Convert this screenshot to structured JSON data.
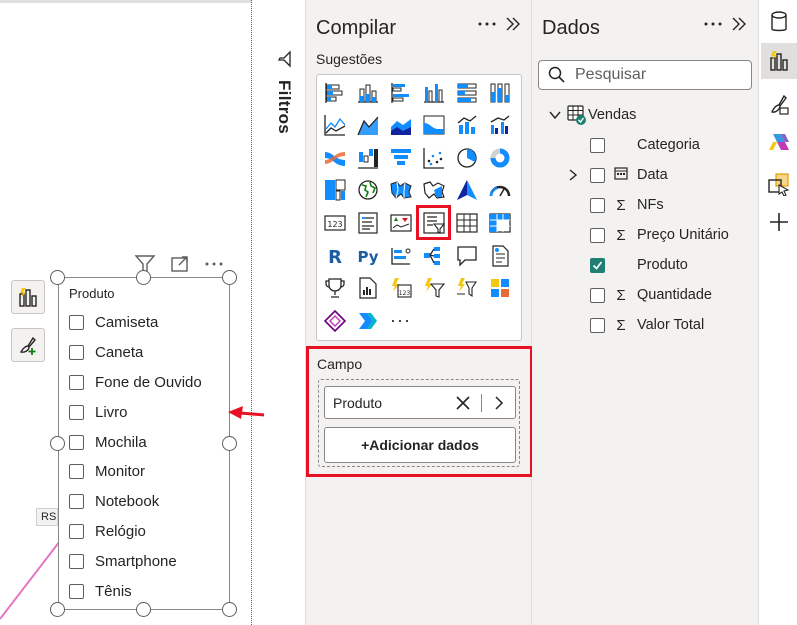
{
  "canvas": {
    "slicer": {
      "title": "Produto",
      "items": [
        "Camiseta",
        "Caneta",
        "Fone de Ouvido",
        "Livro",
        "Mochila",
        "Monitor",
        "Notebook",
        "Relógio",
        "Smartphone",
        "Tênis"
      ]
    },
    "tag": "RS"
  },
  "filters_pane": {
    "label": "Filtros"
  },
  "build_pane": {
    "title": "Compilar",
    "suggestions_label": "Sugestões",
    "field_section_label": "Campo",
    "field_value": "Produto",
    "add_data_label": "+Adicionar dados",
    "more_visuals": "···"
  },
  "data_pane": {
    "title": "Dados",
    "search_placeholder": "Pesquisar",
    "table": "Vendas",
    "fields": [
      {
        "label": "Categoria",
        "checked": false,
        "sigma": false,
        "expandable": false
      },
      {
        "label": "Data",
        "checked": false,
        "sigma": false,
        "expandable": true
      },
      {
        "label": "NFs",
        "checked": false,
        "sigma": true,
        "expandable": false
      },
      {
        "label": "Preço Unitário",
        "checked": false,
        "sigma": true,
        "expandable": false
      },
      {
        "label": "Produto",
        "checked": true,
        "sigma": false,
        "expandable": false
      },
      {
        "label": "Quantidade",
        "checked": false,
        "sigma": true,
        "expandable": false
      },
      {
        "label": "Valor Total",
        "checked": false,
        "sigma": true,
        "expandable": false
      }
    ]
  },
  "colors": {
    "highlight": "#e81123",
    "accent": "#1f7f73",
    "pane_bg": "#f3f2f1"
  }
}
